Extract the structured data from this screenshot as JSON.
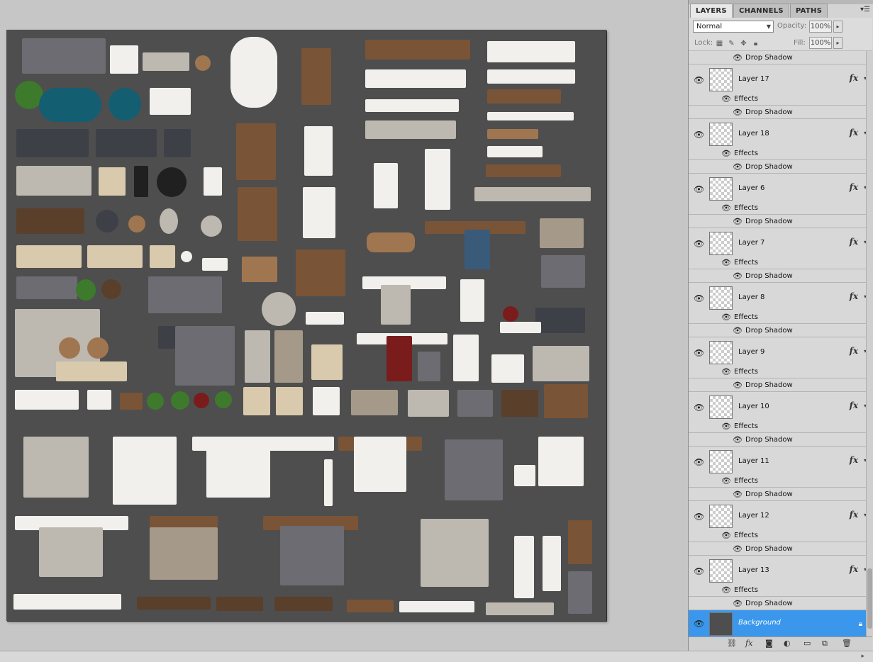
{
  "panel": {
    "tabs": [
      "LAYERS",
      "CHANNELS",
      "PATHS"
    ],
    "blend_mode": "Normal",
    "opacity_label": "Opacity:",
    "opacity_value": "100%",
    "lock_label": "Lock:",
    "fill_label": "Fill:",
    "fill_value": "100%",
    "top_partial_effect": "Drop Shadow",
    "layers": [
      {
        "name": "Layer 17",
        "effects": "Effects",
        "effect": "Drop Shadow"
      },
      {
        "name": "Layer 18",
        "effects": "Effects",
        "effect": "Drop Shadow"
      },
      {
        "name": "Layer 6",
        "effects": "Effects",
        "effect": "Drop Shadow"
      },
      {
        "name": "Layer 7",
        "effects": "Effects",
        "effect": "Drop Shadow"
      },
      {
        "name": "Layer 8",
        "effects": "Effects",
        "effect": "Drop Shadow"
      },
      {
        "name": "Layer 9",
        "effects": "Effects",
        "effect": "Drop Shadow"
      },
      {
        "name": "Layer 10",
        "effects": "Effects",
        "effect": "Drop Shadow"
      },
      {
        "name": "Layer 11",
        "effects": "Effects",
        "effect": "Drop Shadow"
      },
      {
        "name": "Layer 12",
        "effects": "Effects",
        "effect": "Drop Shadow"
      },
      {
        "name": "Layer 13",
        "effects": "Effects",
        "effect": "Drop Shadow"
      }
    ],
    "background_layer": "Background",
    "fx_glyph": "fx",
    "selection_color": "#3a97ec"
  }
}
